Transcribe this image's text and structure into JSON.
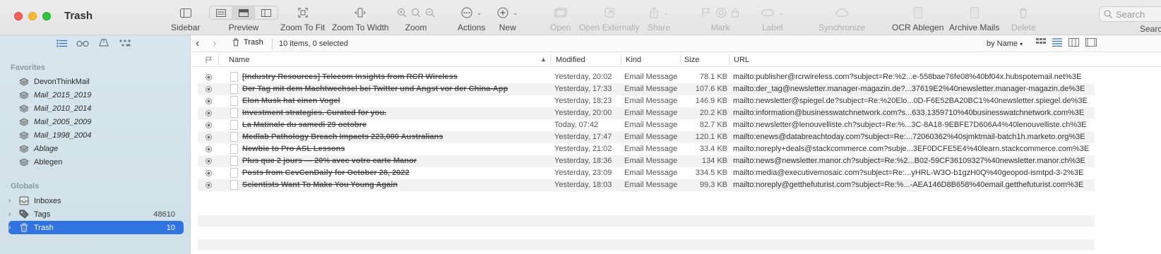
{
  "window": {
    "title": "Trash"
  },
  "toolbar": {
    "sidebar": "Sidebar",
    "preview": "Preview",
    "zoom_to_fit": "Zoom To Fit",
    "zoom_to_width": "Zoom To Width",
    "zoom": "Zoom",
    "actions": "Actions",
    "new": "New",
    "open": "Open",
    "open_externally": "Open Externally",
    "share": "Share",
    "mark": "Mark",
    "label": "Label",
    "synchronize": "Synchronize",
    "ocr_ablegen": "OCR Ablegen",
    "archive_mails": "Archive Mails",
    "delete": "Delete",
    "search_placeholder": "Search",
    "search_label": "Search"
  },
  "sidebar": {
    "favorites_header": "Favorites",
    "favorites": [
      {
        "label": "DevonThinkMail"
      },
      {
        "label": "Mail_2015_2019"
      },
      {
        "label": "Mail_2010_2014"
      },
      {
        "label": "Mail_2005_2009"
      },
      {
        "label": "Mail_1998_2004"
      },
      {
        "label": "Ablage"
      },
      {
        "label": "Ablegen"
      }
    ],
    "globals_header": "Globals",
    "globals": [
      {
        "label": "Inboxes",
        "count": ""
      },
      {
        "label": "Tags",
        "count": "48610"
      },
      {
        "label": "Trash",
        "count": "10"
      }
    ]
  },
  "pathbar": {
    "crumb": "Trash",
    "items_count": "10 items, 0 selected",
    "sort_by": "by Name"
  },
  "table": {
    "columns": {
      "name": "Name",
      "modified": "Modified",
      "kind": "Kind",
      "size": "Size",
      "url": "URL"
    },
    "rows": [
      {
        "name": "[Industry Resources] Telecom Insights from RCR Wireless",
        "modified": "Yesterday, 20:02",
        "kind": "Email Message",
        "size": "78.1 KB",
        "url": "mailto:publisher@rcrwireless.com?subject=Re:%2...e-558bae76fe08%40bf04x.hubspotemail.net%3E"
      },
      {
        "name": "Der Tag mit dem Machtwechsel bei Twitter und Angst vor der China-App",
        "modified": "Yesterday, 17:33",
        "kind": "Email Message",
        "size": "107.6 KB",
        "url": "mailto:der_tag@newsletter.manager-magazin.de?...37619E2%40newsletter.manager-magazin.de%3E"
      },
      {
        "name": "Elon Musk hat einen Vogel",
        "modified": "Yesterday, 18:23",
        "kind": "Email Message",
        "size": "146.9 KB",
        "url": "mailto:newsletter@spiegel.de?subject=Re:%20Elo...0D-F6E52BA20BC1%40newsletter.spiegel.de%3E"
      },
      {
        "name": "Investment strategies. Curated for you.",
        "modified": "Yesterday, 20:00",
        "kind": "Email Message",
        "size": "20.2 KB",
        "url": "mailto:information@businesswatchnetwork.com?s...633.1359710%40businesswatchnetwork.com%3E"
      },
      {
        "name": "La Matinale du samedi 29 octobre",
        "modified": "Today, 07:42",
        "kind": "Email Message",
        "size": "82.7 KB",
        "url": "mailto:newsletter@lenouvelliste.ch?subject=Re:%...3C-8A18-9EBFE7D606A4%40lenouvelliste.ch%3E"
      },
      {
        "name": "Medlab Pathology Breach Impacts 223,000 Australians",
        "modified": "Yesterday, 17:47",
        "kind": "Email Message",
        "size": "120.1 KB",
        "url": "mailto:enews@databreachtoday.com?subject=Re:...72060362%40sjmktmail-batch1h.marketo.org%3E"
      },
      {
        "name": "Newbie to Pro ASL Lessons",
        "modified": "Yesterday, 21:02",
        "kind": "Email Message",
        "size": "33.4 KB",
        "url": "mailto:noreply+deals@stackcommerce.com?subje...3EF0DCFE5E4%40learn.stackcommerce.com%3E"
      },
      {
        "name": "Plus que 2 jours — 20% avec votre carte Manor",
        "modified": "Yesterday, 18:36",
        "kind": "Email Message",
        "size": "134 KB",
        "url": "mailto:news@newsletter.manor.ch?subject=Re:%2...B02-59CF36109327%40newsletter.manor.ch%3E"
      },
      {
        "name": "Posts from CevCenDaily for October 28, 2022",
        "modified": "Yesterday, 23:09",
        "kind": "Email Message",
        "size": "334.5 KB",
        "url": "mailto:media@executivemosaic.com?subject=Re:...yHRL-W3O-b1gzH0Q%40geopod-ismtpd-3-2%3E"
      },
      {
        "name": "Scientists Want To Make You Young Again",
        "modified": "Yesterday, 18:03",
        "kind": "Email Message",
        "size": "99.3 KB",
        "url": "mailto:noreply@getthefuturist.com?subject=Re:%...-AEA146D8B658%40email.getthefuturist.com%3E"
      }
    ]
  },
  "colors": {
    "selection": "#2f74e0",
    "sidebar_bg": "#d6e6ec",
    "accent": "#2b6fd6"
  }
}
